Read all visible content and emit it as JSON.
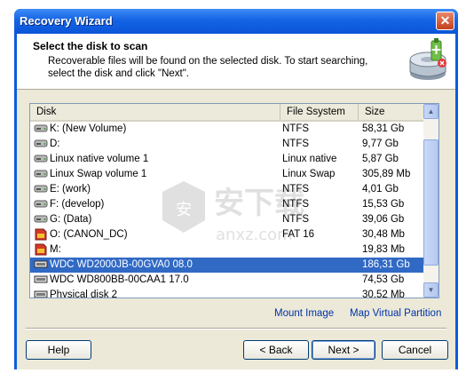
{
  "window": {
    "title": "Recovery Wizard",
    "close_glyph": "✕"
  },
  "header": {
    "title": "Select the disk to scan",
    "description": "Recoverable files will be found on the selected disk. To start searching, select the disk and click \"Next\".",
    "icon": "disk-recovery-icon"
  },
  "table": {
    "columns": [
      "Disk",
      "File Ssystem",
      "Size"
    ],
    "rows": [
      {
        "name": "K: (New Volume)",
        "fs": "NTFS",
        "size": "58,31 Gb",
        "icon": "drive-icon"
      },
      {
        "name": "D:",
        "fs": "NTFS",
        "size": "9,77 Gb",
        "icon": "drive-icon"
      },
      {
        "name": "Linux native volume 1",
        "fs": "Linux native",
        "size": "5,87 Gb",
        "icon": "drive-icon"
      },
      {
        "name": "Linux Swap volume 1",
        "fs": "Linux Swap",
        "size": "305,89 Mb",
        "icon": "drive-icon"
      },
      {
        "name": "E: (work)",
        "fs": "NTFS",
        "size": "4,01 Gb",
        "icon": "drive-icon"
      },
      {
        "name": "F: (develop)",
        "fs": "NTFS",
        "size": "15,53 Gb",
        "icon": "drive-icon"
      },
      {
        "name": "G: (Data)",
        "fs": "NTFS",
        "size": "39,06 Gb",
        "icon": "drive-icon"
      },
      {
        "name": "O: (CANON_DC)",
        "fs": "FAT 16",
        "size": "30,48 Mb",
        "icon": "memory-card-icon"
      },
      {
        "name": "M:",
        "fs": "",
        "size": "19,83 Mb",
        "icon": "memory-card-icon"
      },
      {
        "name": "WDC WD2000JB-00GVA0 08.0",
        "fs": "",
        "size": "186,31 Gb",
        "icon": "hard-disk-icon",
        "selected": true
      },
      {
        "name": "WDC WD800BB-00CAA1 17.0",
        "fs": "",
        "size": "74,53 Gb",
        "icon": "hard-disk-icon"
      },
      {
        "name": "Physical disk 2",
        "fs": "",
        "size": "30,52 Mb",
        "icon": "hard-disk-icon"
      }
    ]
  },
  "links": {
    "mount_image": "Mount Image",
    "map_partition": "Map Virtual Partition"
  },
  "buttons": {
    "help": "Help",
    "back": "< Back",
    "next": "Next >",
    "cancel": "Cancel"
  },
  "watermark": {
    "text": "安下载",
    "subtext": "anxz.com"
  }
}
